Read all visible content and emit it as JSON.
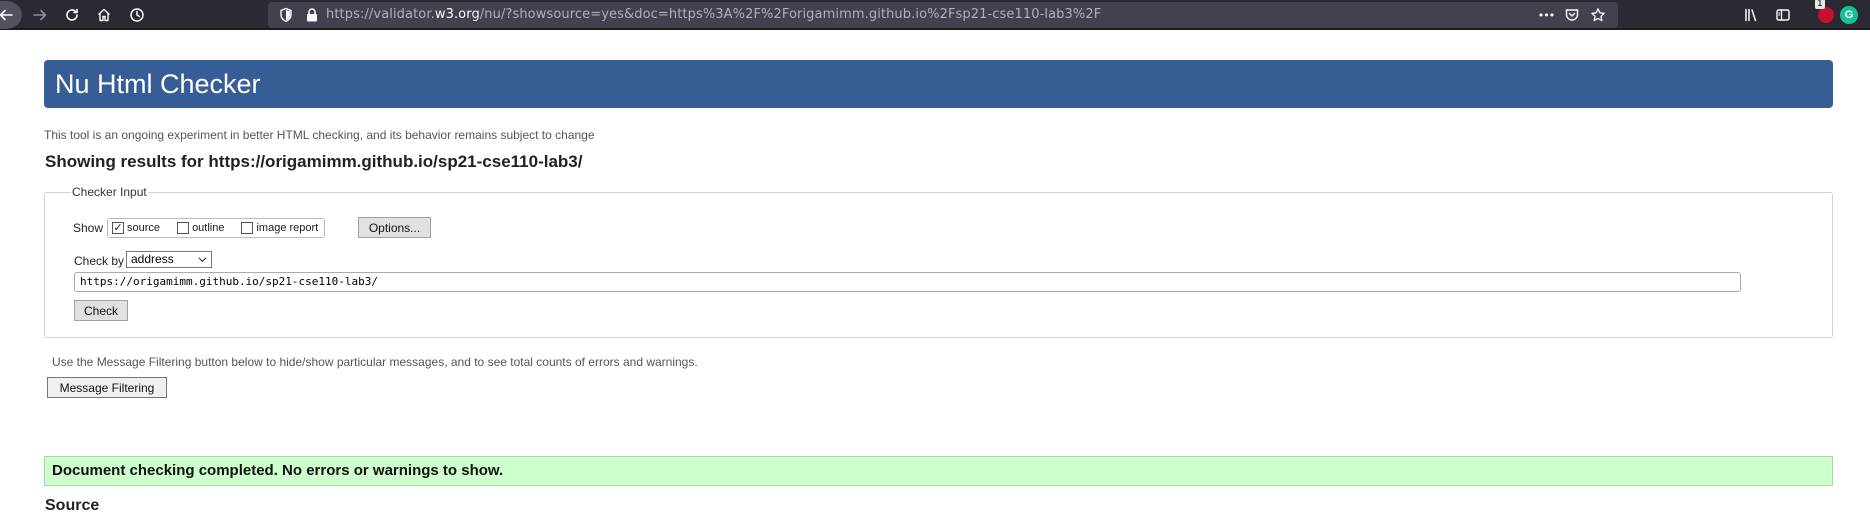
{
  "browser": {
    "url_prefix": "https://validator.",
    "url_domain": "w3.org",
    "url_rest": "/nu/?showsource=yes&doc=https%3A%2F%2Forigamimm.github.io%2Fsp21-cse110-lab3%2F",
    "extension_badge_count": "1",
    "grammarly_letter": "G",
    "more_label": "•••"
  },
  "page": {
    "title": "Nu Html Checker",
    "tagline": "This tool is an ongoing experiment in better HTML checking, and its behavior remains subject to change",
    "results_line": "Showing results for https://origamimm.github.io/sp21-cse110-lab3/"
  },
  "checker": {
    "legend": "Checker Input",
    "show_label": "Show",
    "options": [
      {
        "label": "source",
        "checked": true
      },
      {
        "label": "outline",
        "checked": false
      },
      {
        "label": "image report",
        "checked": false
      }
    ],
    "options_button": "Options...",
    "check_by_label": "Check by",
    "check_by_value": "address",
    "doc_url": "https://origamimm.github.io/sp21-cse110-lab3/",
    "check_button": "Check"
  },
  "filtering": {
    "note": "Use the Message Filtering button below to hide/show particular messages, and to see total counts of errors and warnings.",
    "button": "Message Filtering"
  },
  "result": {
    "message": "Document checking completed. No errors or warnings to show.",
    "success_color": "#ccffcc"
  },
  "source": {
    "heading": "Source"
  },
  "colors": {
    "header_bar": "#365d95",
    "toolbar": "#2b2a33",
    "url_bar": "#42414d"
  }
}
